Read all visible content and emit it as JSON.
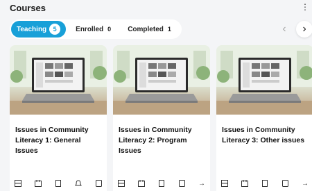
{
  "page": {
    "title": "Courses",
    "menu_icon": "kebab-icon"
  },
  "tabs": [
    {
      "label": "Teaching",
      "count": "5",
      "active": true
    },
    {
      "label": "Enrolled",
      "count": "0",
      "active": false
    },
    {
      "label": "Completed",
      "count": "1",
      "active": false
    }
  ],
  "nav": {
    "prev_icon": "chevron-left-icon",
    "next_icon": "chevron-right-icon"
  },
  "courses": [
    {
      "title": "Issues in Community Literacy 1: General Issues",
      "thumbnail": "laptop-on-desk-image",
      "actions": [
        "grid-icon",
        "calendar-icon",
        "document-icon",
        "bell-icon",
        "page-icon"
      ]
    },
    {
      "title": "Issues in Community Literacy 2: Program Issues",
      "thumbnail": "laptop-on-desk-image",
      "actions": [
        "grid-icon",
        "calendar-icon",
        "document-icon",
        "page-icon",
        "arrow-right-icon"
      ]
    },
    {
      "title": "Issues in Community Literacy 3: Other issues",
      "thumbnail": "laptop-on-desk-image",
      "actions": [
        "grid-icon",
        "calendar-icon",
        "document-icon",
        "page-icon",
        "arrow-right-icon"
      ]
    }
  ],
  "colors": {
    "accent": "#18a0d8",
    "background": "#f4f5f7",
    "card": "#ffffff"
  }
}
